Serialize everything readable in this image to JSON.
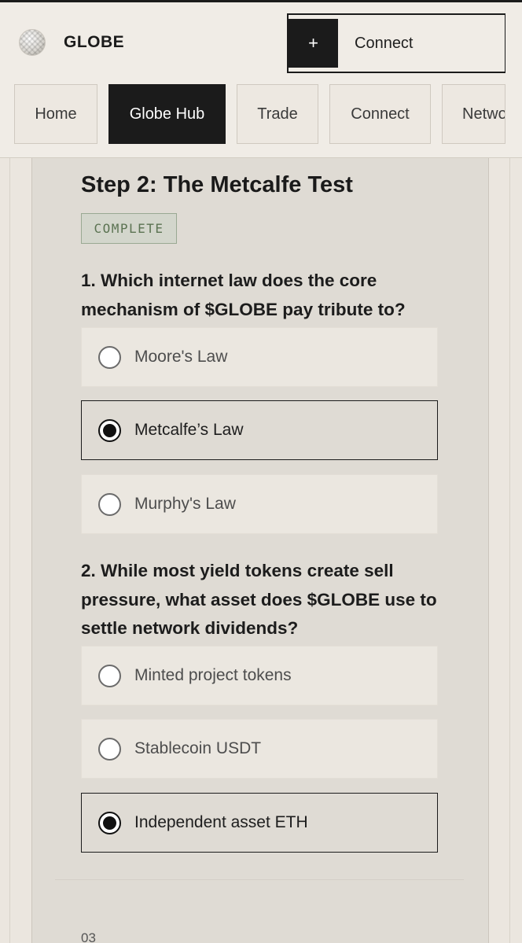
{
  "header": {
    "brand": "GLOBE",
    "connect_icon": "+",
    "connect_label": "Connect"
  },
  "nav": {
    "tabs": [
      {
        "label": "Home",
        "active": false
      },
      {
        "label": "Globe Hub",
        "active": true
      },
      {
        "label": "Trade",
        "active": false
      },
      {
        "label": "Connect",
        "active": false
      },
      {
        "label": "Network",
        "active": false
      }
    ]
  },
  "step": {
    "title": "Step 2: The Metcalfe Test",
    "status": "COMPLETE"
  },
  "questions": [
    {
      "text": "1. Which internet law does the core mechanism of $GLOBE pay tribute to?",
      "options": [
        {
          "label": "Moore's Law",
          "selected": false
        },
        {
          "label": "Metcalfe’s Law",
          "selected": true
        },
        {
          "label": "Murphy's Law",
          "selected": false
        }
      ]
    },
    {
      "text": "2. While most yield tokens create sell pressure, what asset does $GLOBE use to settle network dividends?",
      "options": [
        {
          "label": "Minted project tokens",
          "selected": false
        },
        {
          "label": "Stablecoin USDT",
          "selected": false
        },
        {
          "label": "Independent asset ETH",
          "selected": true
        }
      ]
    }
  ],
  "footer": {
    "step_number": "03"
  },
  "colors": {
    "accent": "#1b1b1b",
    "background": "#ebe6df",
    "panel": "#dfdbd4",
    "badge_text": "#5b7352"
  }
}
